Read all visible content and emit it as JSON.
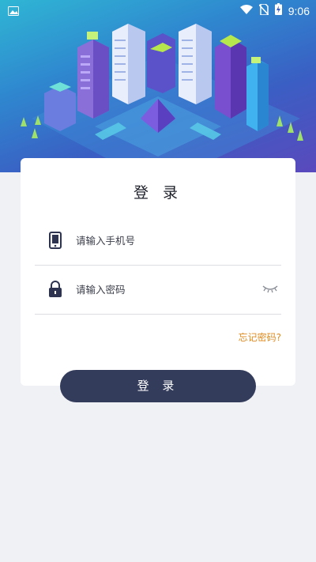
{
  "status_bar": {
    "time": "9:06"
  },
  "login": {
    "title": "登 录",
    "phone_placeholder": "请输入手机号",
    "password_placeholder": "请输入密码",
    "forgot_password": "忘记密码?",
    "submit_label": "登 录"
  },
  "colors": {
    "accent": "#e08a1e",
    "button": "#343c5c",
    "background": "#f0f1f5"
  },
  "icons": {
    "phone": "mobile-phone-icon",
    "password": "padlock-icon",
    "toggle": "eye-closed-icon"
  }
}
